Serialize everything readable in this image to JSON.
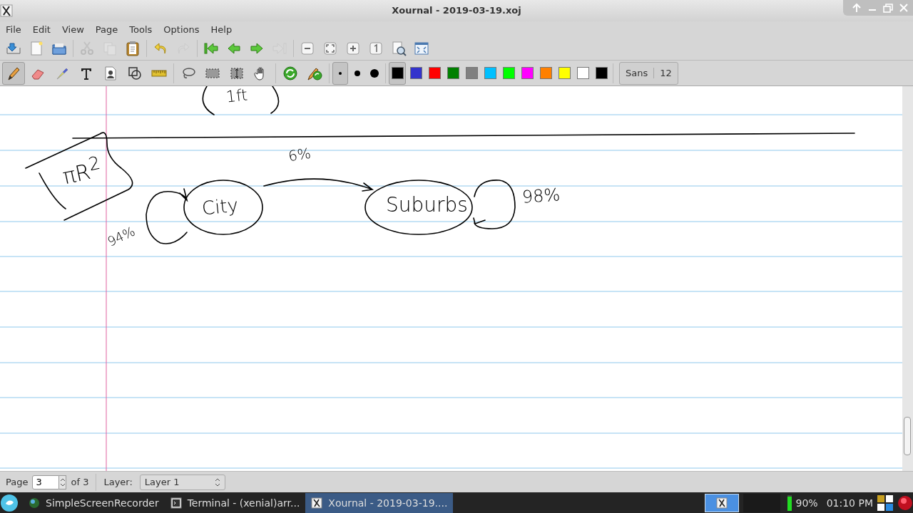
{
  "window": {
    "title": "Xournal - 2019-03-19.xoj"
  },
  "menu": [
    "File",
    "Edit",
    "View",
    "Page",
    "Tools",
    "Options",
    "Help"
  ],
  "main_toolbar": [
    {
      "disabled": false
    },
    {
      "disabled": false
    },
    {
      "disabled": false
    },
    {
      "disabled": true
    },
    {
      "disabled": true
    },
    {
      "disabled": false
    },
    {
      "disabled": false
    },
    {
      "disabled": true
    },
    {
      "disabled": false
    },
    {
      "disabled": false
    },
    {
      "disabled": false
    },
    {
      "disabled": true
    },
    {
      "disabled": false
    },
    {
      "disabled": false
    },
    {
      "disabled": false
    },
    {
      "disabled": false
    },
    {
      "disabled": false
    },
    {
      "disabled": false
    }
  ],
  "tools": [
    {
      "selected": true
    },
    {
      "selected": false
    },
    {
      "selected": false
    },
    {
      "selected": false
    },
    {
      "selected": false
    },
    {
      "selected": false
    },
    {
      "selected": false
    },
    {
      "selected": false
    },
    {
      "selected": false
    },
    {
      "selected": false
    },
    {
      "selected": false
    },
    {
      "selected": false
    },
    {
      "selected": false
    }
  ],
  "thickness": [
    {
      "selected": true
    },
    {
      "selected": false
    },
    {
      "selected": false
    }
  ],
  "colors": [
    {
      "color": "#000000",
      "selected": true
    },
    {
      "color": "#3333cc",
      "selected": false
    },
    {
      "color": "#ff0000",
      "selected": false
    },
    {
      "color": "#008000",
      "selected": false
    },
    {
      "color": "#808080",
      "selected": false
    },
    {
      "color": "#00c0ff",
      "selected": false
    },
    {
      "color": "#00ff00",
      "selected": false
    },
    {
      "color": "#ff00ff",
      "selected": false
    },
    {
      "color": "#ff8000",
      "selected": false
    },
    {
      "color": "#ffff00",
      "selected": false
    },
    {
      "color": "#ffffff",
      "selected": false
    },
    {
      "color": "#000000",
      "selected": false
    }
  ],
  "font": {
    "name": "Sans",
    "size": "12"
  },
  "canvas": {
    "notes": [
      {
        "text": "1ft"
      },
      {
        "text": "πR$^{2}$"
      },
      {
        "text": "6%"
      },
      {
        "text": "City"
      },
      {
        "text": "Suburbs"
      },
      {
        "text": "98%"
      },
      {
        "text": "94%"
      }
    ]
  },
  "status_bar": {
    "page_label": "Page",
    "page": "3",
    "page_count": "of 3",
    "layer_label": "Layer:",
    "layer": "Layer 1"
  },
  "taskbar": {
    "tasks": [
      {
        "label": "SimpleScreenRecorder",
        "selected": false
      },
      {
        "label": "Terminal - (xenial)arr...",
        "selected": false
      },
      {
        "label": "Xournal - 2019-03-19....",
        "selected": true
      }
    ],
    "battery": "90%",
    "clock": "01:10 PM"
  }
}
